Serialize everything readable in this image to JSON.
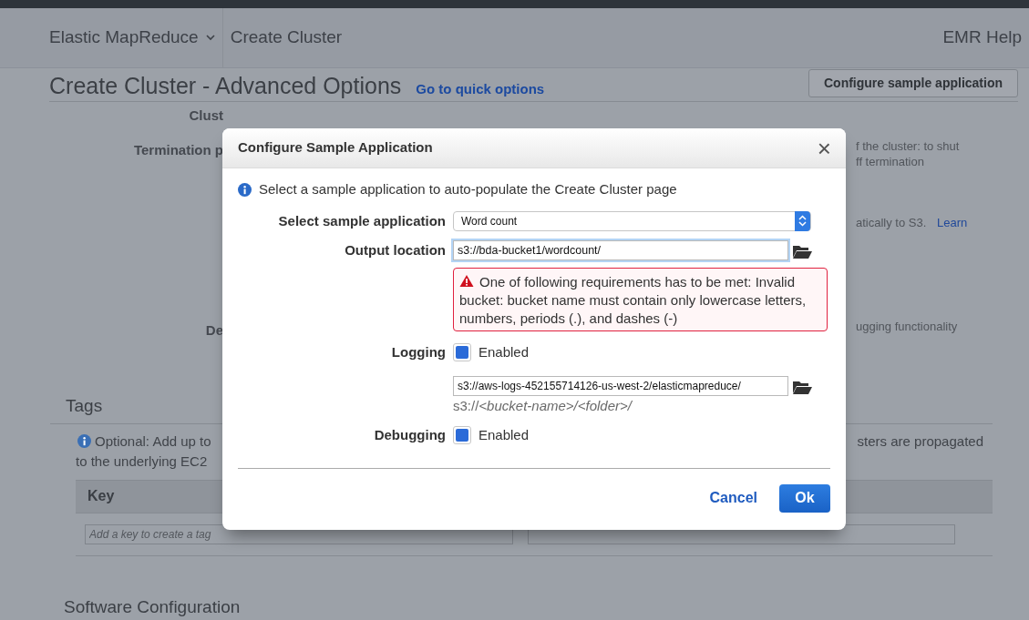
{
  "top_nav": {
    "service_menu": "Elastic MapReduce",
    "breadcrumb": "Create Cluster",
    "help_link": "EMR Help"
  },
  "page": {
    "title": "Create Cluster - Advanced Options",
    "quick_options_link": "Go to quick options",
    "configure_button": "Configure sample application"
  },
  "form_fragments": [
    {
      "label": "Clust"
    },
    {
      "label": "Termination p",
      "note": [
        "f the cluster: to shut",
        "ff termination"
      ]
    },
    {
      "note": [
        "atically to S3."
      ],
      "link": "Learn"
    },
    {
      "label": "De",
      "note": [
        "ugging functionality"
      ]
    }
  ],
  "tags": {
    "title": "Tags",
    "info_start": "Optional: Add up to",
    "info_end": "sters are propagated",
    "info_line2": "to the underlying EC2",
    "columns": [
      "Key"
    ],
    "key_placeholder": "Add a key to create a tag"
  },
  "next_section_title": "Software Configuration",
  "modal": {
    "title": "Configure Sample Application",
    "info": "Select a sample application to auto-populate the Create Cluster page",
    "fields": [
      {
        "kind": "select",
        "label": "Select sample application",
        "value": "Word count"
      },
      {
        "kind": "path",
        "label": "Output location",
        "value": "s3://bda-bucket1/wordcount/",
        "error": "One of following requirements has to be met: Invalid bucket: bucket name must contain only lowercase letters, numbers, periods (.), and dashes (-)"
      },
      {
        "kind": "checkbox",
        "label": "Logging",
        "text": "Enabled",
        "checked": true,
        "path": "s3://aws-logs-452155714126-us-west-2/elasticmapreduce/",
        "hint": "s3://*<bucket-name>/<folder>/*"
      },
      {
        "kind": "checkbox",
        "label": "Debugging",
        "text": "Enabled",
        "checked": true
      }
    ],
    "close": "×",
    "cancel": "Cancel",
    "ok": "Ok"
  }
}
